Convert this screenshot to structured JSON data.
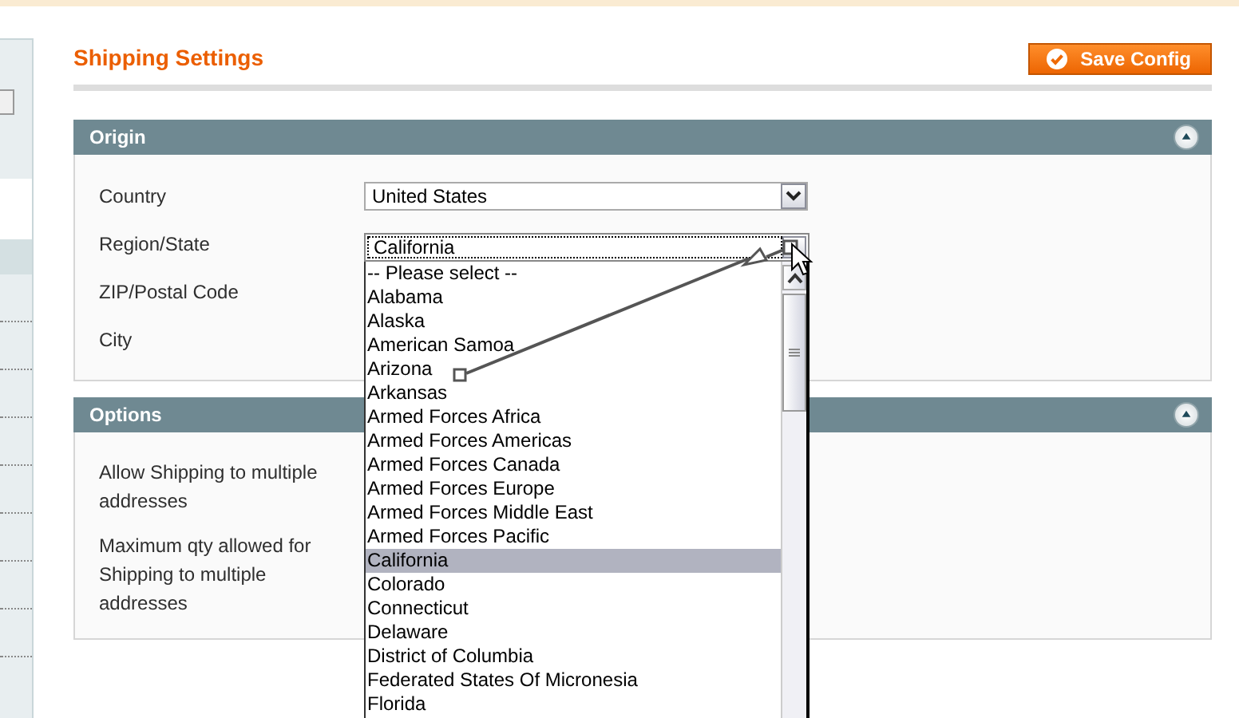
{
  "header": {
    "title": "Shipping Settings",
    "save_button": "Save Config"
  },
  "sections": [
    {
      "title": "Origin",
      "expanded": true,
      "fields": [
        {
          "label": "Country",
          "value": "United States"
        },
        {
          "label": "Region/State",
          "value": "California",
          "open": true
        },
        {
          "label": "ZIP/Postal Code"
        },
        {
          "label": "City"
        }
      ]
    },
    {
      "title": "Options",
      "expanded": true,
      "fields": [
        {
          "label": "Allow Shipping to multiple addresses"
        },
        {
          "label": "Maximum qty allowed for Shipping to multiple addresses"
        }
      ]
    }
  ],
  "dropdown": {
    "options": [
      {
        "label": "-- Please select --",
        "selected": false
      },
      {
        "label": "Alabama",
        "selected": false
      },
      {
        "label": "Alaska",
        "selected": false
      },
      {
        "label": "American Samoa",
        "selected": false
      },
      {
        "label": "Arizona",
        "selected": false
      },
      {
        "label": "Arkansas",
        "selected": false
      },
      {
        "label": "Armed Forces Africa",
        "selected": false
      },
      {
        "label": "Armed Forces Americas",
        "selected": false
      },
      {
        "label": "Armed Forces Canada",
        "selected": false
      },
      {
        "label": "Armed Forces Europe",
        "selected": false
      },
      {
        "label": "Armed Forces Middle East",
        "selected": false
      },
      {
        "label": "Armed Forces Pacific",
        "selected": false
      },
      {
        "label": "California",
        "selected": true
      },
      {
        "label": "Colorado",
        "selected": false
      },
      {
        "label": "Connecticut",
        "selected": false
      },
      {
        "label": "Delaware",
        "selected": false
      },
      {
        "label": "District of Columbia",
        "selected": false
      },
      {
        "label": "Federated States Of Micronesia",
        "selected": false
      },
      {
        "label": "Florida",
        "selected": false
      }
    ]
  }
}
